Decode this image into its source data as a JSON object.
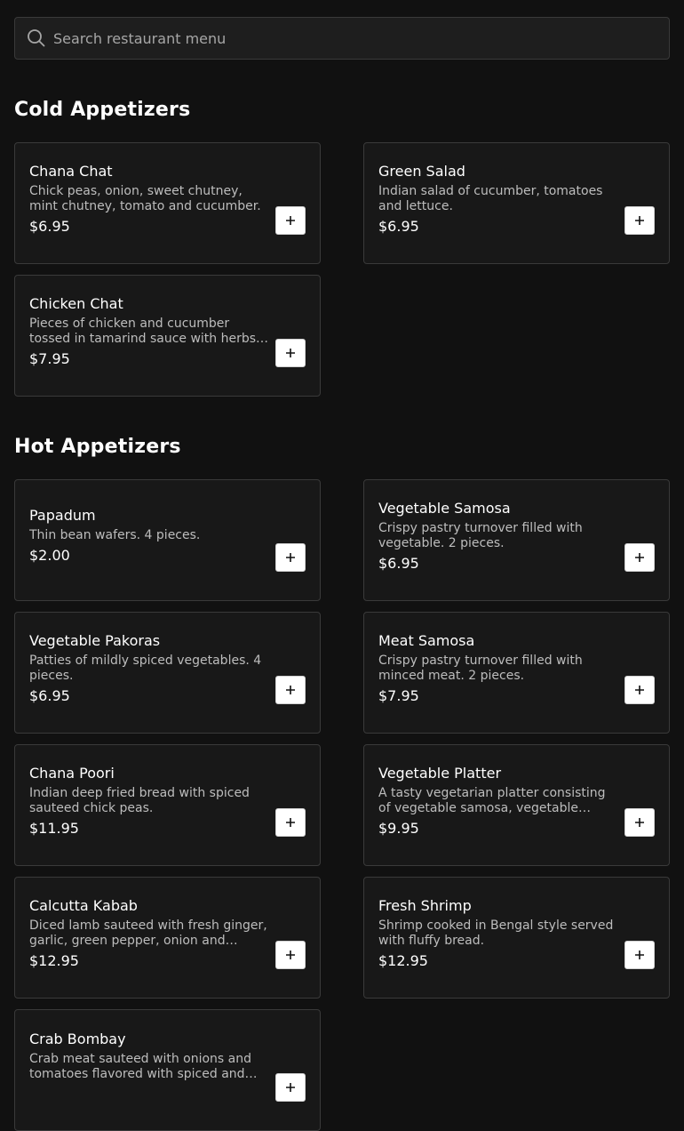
{
  "search": {
    "placeholder": "Search restaurant menu"
  },
  "sections": [
    {
      "title": "Cold Appetizers",
      "items": [
        {
          "name": "Chana Chat",
          "description": "Chick peas, onion, sweet chutney, mint chutney, tomato and cucumber.",
          "price": "$6.95"
        },
        {
          "name": "Green Salad",
          "description": "Indian salad of cucumber, tomatoes and lettuce.",
          "price": "$6.95"
        },
        {
          "name": "Chicken Chat",
          "description": "Pieces of chicken and cucumber tossed in tamarind sauce with herbs and spices.",
          "price": "$7.95"
        }
      ]
    },
    {
      "title": "Hot Appetizers",
      "items": [
        {
          "name": "Papadum",
          "description": "Thin bean wafers. 4 pieces.",
          "price": "$2.00"
        },
        {
          "name": "Vegetable Samosa",
          "description": "Crispy pastry turnover filled with vegetable. 2 pieces.",
          "price": "$6.95"
        },
        {
          "name": "Vegetable Pakoras",
          "description": "Patties of mildly spiced vegetables. 4 pieces.",
          "price": "$6.95"
        },
        {
          "name": "Meat Samosa",
          "description": "Crispy pastry turnover filled with minced meat. 2 pieces.",
          "price": "$7.95"
        },
        {
          "name": "Chana Poori",
          "description": "Indian deep fried bread with spiced sauteed chick peas.",
          "price": "$11.95"
        },
        {
          "name": "Vegetable Platter",
          "description": "A tasty vegetarian platter consisting of vegetable samosa, vegetable pakora and...",
          "price": "$9.95"
        },
        {
          "name": "Calcutta Kabab",
          "description": "Diced lamb sauteed with fresh ginger, garlic, green pepper, onion and tomatoes...",
          "price": "$12.95"
        },
        {
          "name": "Fresh Shrimp",
          "description": "Shrimp cooked in Bengal style served with fluffy bread.",
          "price": "$12.95"
        },
        {
          "name": "Crab Bombay",
          "description": "Crab meat sauteed with onions and tomatoes flavored with spiced and herbs.",
          "price": ""
        }
      ]
    }
  ],
  "icons": {
    "search": "search-icon",
    "add": "plus-icon"
  },
  "colors": {
    "background": "#111111",
    "card": "#181818",
    "border": "#3a3a3a",
    "button": "#ffffff"
  }
}
